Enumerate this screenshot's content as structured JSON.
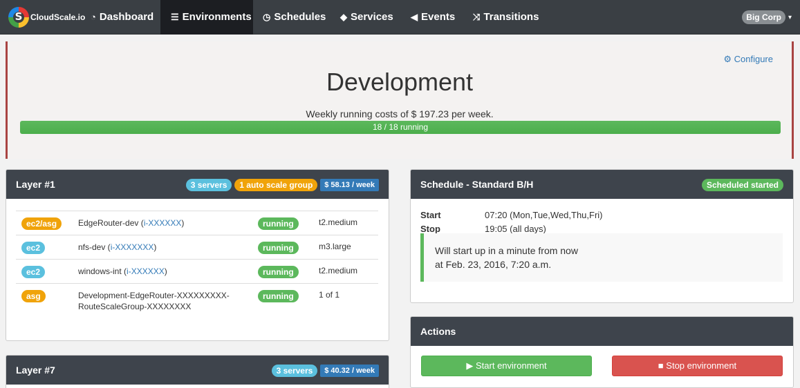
{
  "brand": {
    "name": "CloudScale.io",
    "logo_letter": "S"
  },
  "nav": {
    "items": [
      {
        "label": "Dashboard",
        "icon": "dashboard-icon",
        "glyph": "◔"
      },
      {
        "label": "Environments",
        "icon": "list-icon",
        "glyph": "☰"
      },
      {
        "label": "Schedules",
        "icon": "clock-icon",
        "glyph": "◷"
      },
      {
        "label": "Services",
        "icon": "tags-icon",
        "glyph": "◆"
      },
      {
        "label": "Events",
        "icon": "bullhorn-icon",
        "glyph": "◀"
      },
      {
        "label": "Transitions",
        "icon": "random-icon",
        "glyph": "⤨"
      }
    ],
    "account": "Big Corp",
    "caret": "▾"
  },
  "hero": {
    "configure_label": "Configure",
    "configure_icon": "⚙",
    "title": "Development",
    "cost_text": "Weekly running costs of $ 197.23 per week.",
    "progress_label": "18 / 18 running",
    "progress_fraction": 1.0,
    "accent_color": "#a94442"
  },
  "layer1": {
    "title": "Layer #1",
    "badge_servers": "3 servers",
    "badge_asg": "1 auto scale group",
    "badge_cost": "$ 58.13 / week",
    "rows": [
      {
        "type": "ec2/asg",
        "type_color": "warn",
        "name": "EdgeRouter-dev (",
        "id": "i-XXXXXX",
        "close": ")",
        "status": "running",
        "size": "t2.medium"
      },
      {
        "type": "ec2",
        "type_color": "info",
        "name": "nfs-dev (",
        "id": "i-XXXXXXX",
        "close": ")",
        "status": "running",
        "size": "m3.large"
      },
      {
        "type": "ec2",
        "type_color": "info",
        "name": "windows-int (",
        "id": "i-XXXXXX",
        "close": ")",
        "status": "running",
        "size": "t2.medium"
      },
      {
        "type": "asg",
        "type_color": "warn",
        "name": "Development-EdgeRouter-XXXXXXXXX-RouteScaleGroup-XXXXXXXX",
        "id": "",
        "close": "",
        "status": "running",
        "size": "1 of 1"
      }
    ]
  },
  "layer7": {
    "title": "Layer #7",
    "badge_servers": "3 servers",
    "badge_cost": "$ 40.32 / week"
  },
  "schedule": {
    "title": "Schedule - Standard B/H",
    "status_badge": "Scheduled started",
    "start_label": "Start",
    "start_value": "07:20 (Mon,Tue,Wed,Thu,Fri)",
    "stop_label": "Stop",
    "stop_value": "19:05 (all days)",
    "note_line1": "Will start up in a minute from now",
    "note_line2": "at Feb. 23, 2016, 7:20 a.m."
  },
  "actions": {
    "title": "Actions",
    "start_label": "Start environment",
    "start_icon": "▶",
    "stop_label": "Stop environment",
    "stop_icon": "■"
  }
}
